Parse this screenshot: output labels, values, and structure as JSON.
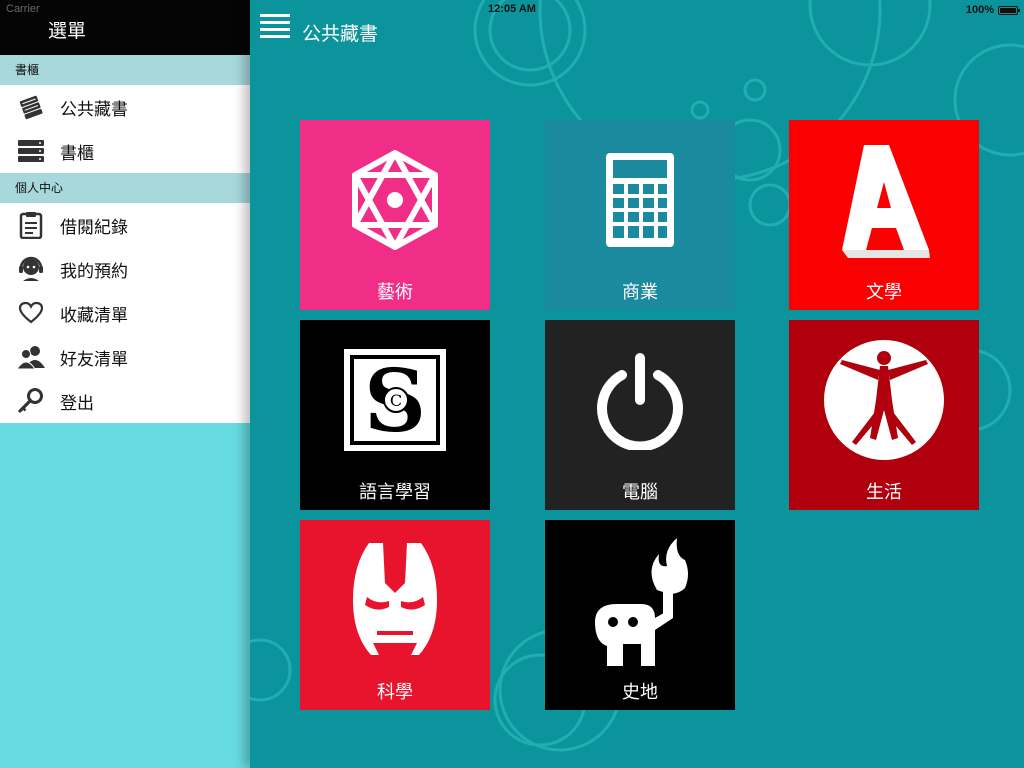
{
  "status_bar": {
    "carrier": "Carrier",
    "time": "12:05 AM",
    "battery": "100%",
    "battery_level": 1.0
  },
  "sidebar": {
    "title": "選單",
    "sections": [
      {
        "header": "書櫃",
        "items": [
          {
            "label": "公共藏書",
            "icon": "books-icon"
          },
          {
            "label": "書櫃",
            "icon": "bookshelf-icon"
          }
        ]
      },
      {
        "header": "個人中心",
        "items": [
          {
            "label": "借閱紀錄",
            "icon": "clipboard-icon"
          },
          {
            "label": "我的預約",
            "icon": "headset-user-icon"
          },
          {
            "label": "收藏清單",
            "icon": "heart-icon"
          },
          {
            "label": "好友清單",
            "icon": "friends-icon"
          },
          {
            "label": "登出",
            "icon": "key-icon"
          }
        ]
      }
    ]
  },
  "main": {
    "title": "公共藏書",
    "tiles": [
      {
        "label": "藝術",
        "color": "#f02d87",
        "icon": "art-star-icon"
      },
      {
        "label": "商業",
        "color": "#1b8a9e",
        "icon": "calculator-icon"
      },
      {
        "label": "文學",
        "color": "#fa0000",
        "icon": "letter-a-icon"
      },
      {
        "label": "語言學習",
        "color": "#000000",
        "icon": "sc-logo-icon"
      },
      {
        "label": "電腦",
        "color": "#222222",
        "icon": "power-icon"
      },
      {
        "label": "生活",
        "color": "#b0000e",
        "icon": "vitruvian-icon"
      },
      {
        "label": "科學",
        "color": "#e8142d",
        "icon": "ironman-icon"
      },
      {
        "label": "史地",
        "color": "#000000",
        "icon": "torch-creature-icon"
      }
    ]
  },
  "colors": {
    "sidebar_bg": "#66dbe0",
    "main_bg": "#0b949b",
    "section_header": "#a7d8dc",
    "header_black": "#050505"
  }
}
